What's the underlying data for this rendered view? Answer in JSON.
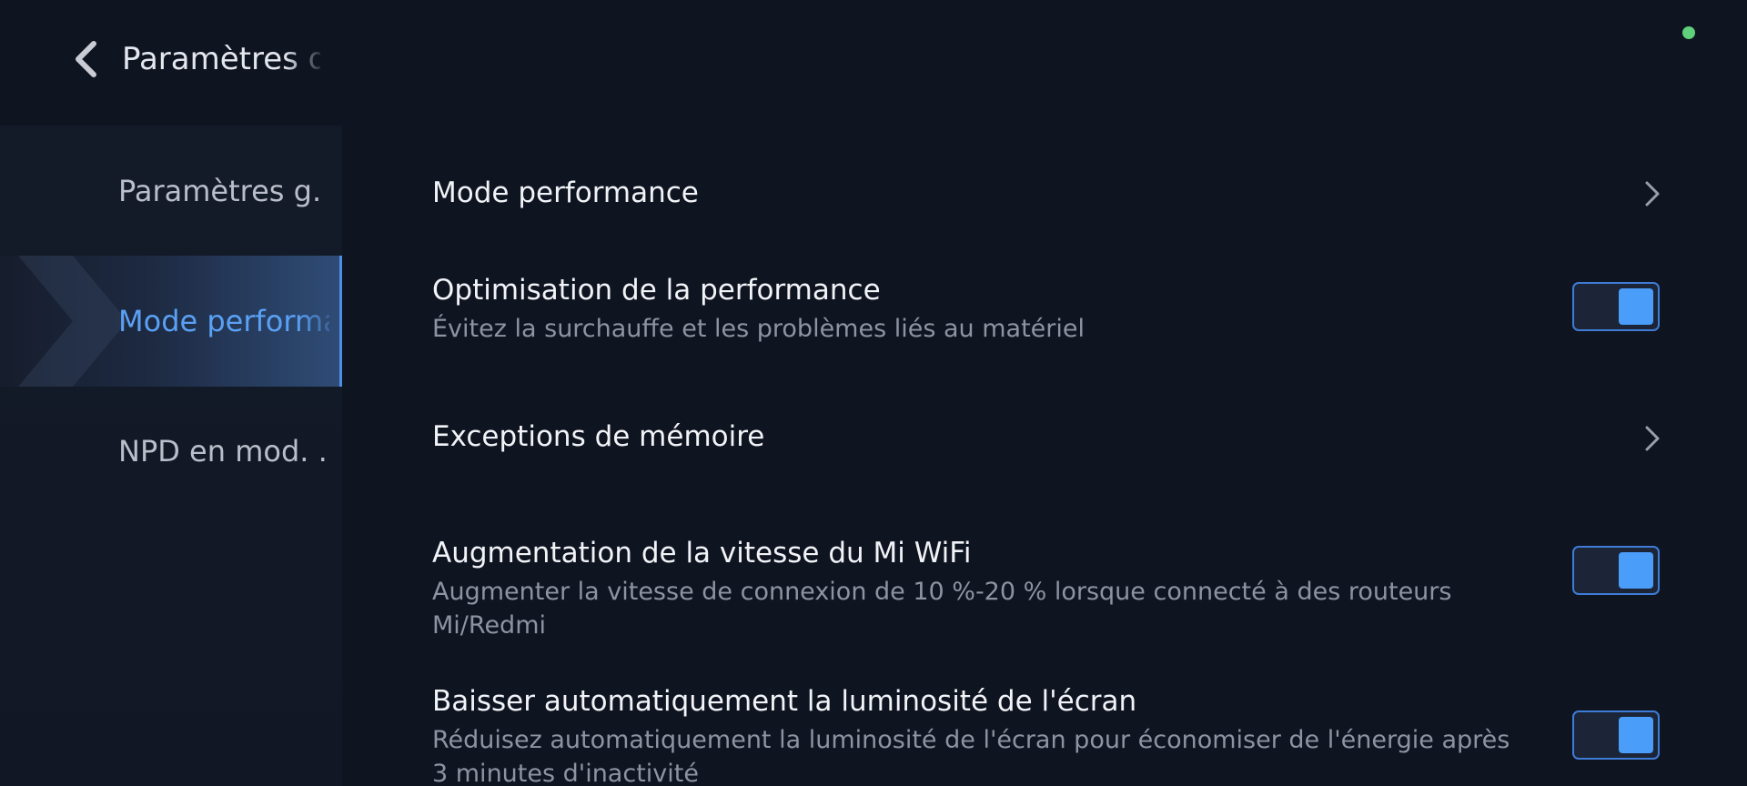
{
  "header": {
    "title": "Paramètres d",
    "back_icon": "chevron-left-icon"
  },
  "status": {
    "dot_color": "#5fd17a"
  },
  "sidebar": {
    "items": [
      {
        "label": "Paramètres g. .",
        "active": false
      },
      {
        "label": "Mode performa",
        "active": true
      },
      {
        "label": "NPD en mod. .",
        "active": false
      }
    ],
    "accent_color": "#5aa1f5"
  },
  "settings": [
    {
      "title": "Mode performance",
      "control": "chevron-right-icon"
    },
    {
      "title": "Optimisation de la performance",
      "description": "Évitez la surchauffe et les problèmes liés au matériel",
      "control": "toggle",
      "enabled": true
    },
    {
      "title": "Exceptions de mémoire",
      "control": "chevron-right-icon"
    },
    {
      "title": "Augmentation de la vitesse du Mi WiFi",
      "description": "Augmenter la vitesse de connexion de 10 %-20 % lorsque connecté à des routeurs Mi/Redmi",
      "control": "toggle",
      "enabled": true
    },
    {
      "title": "Baisser automatiquement la luminosité de l'écran",
      "description": "Réduisez automatiquement la luminosité de l'écran pour économiser de l'énergie après 3 minutes d'inactivité",
      "control": "toggle",
      "enabled": true
    }
  ],
  "colors": {
    "background": "#0f1421",
    "toggle_on": "#4a9df9",
    "toggle_border": "#3e7cd6"
  }
}
